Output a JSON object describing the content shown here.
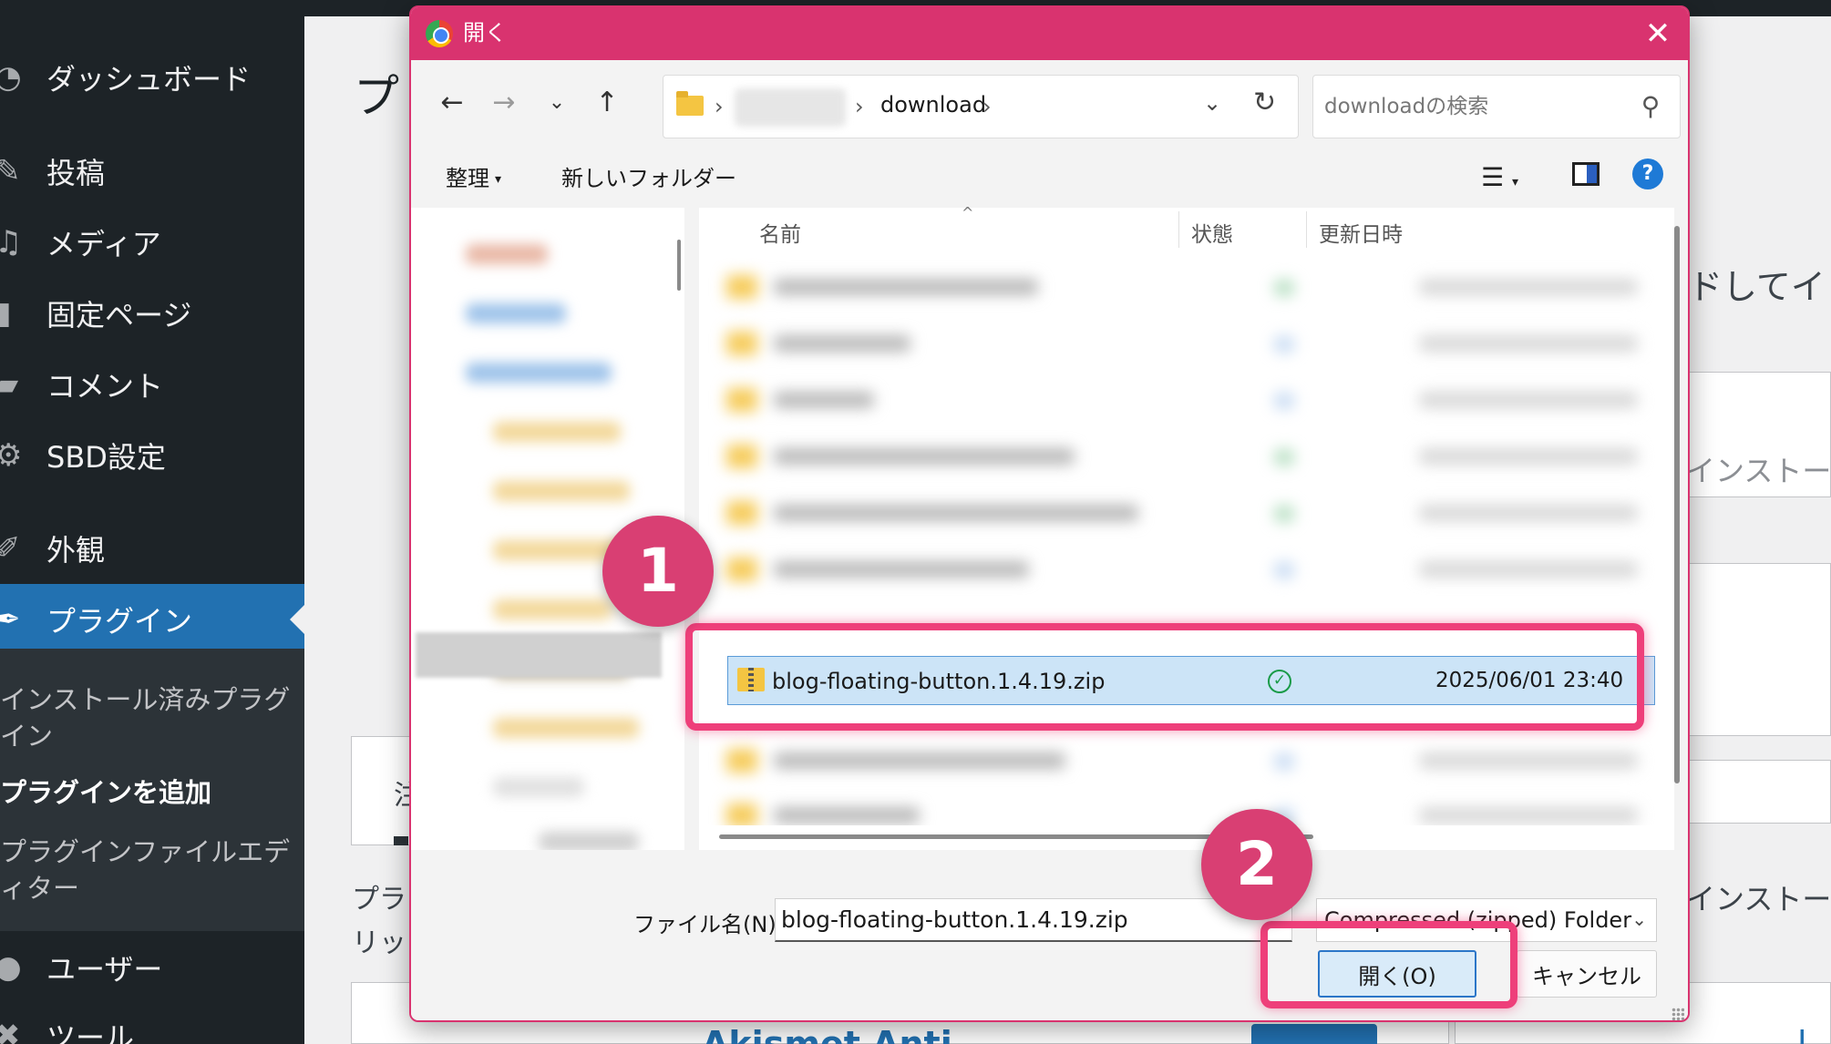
{
  "wp": {
    "sidebar": {
      "items": [
        {
          "label": "ダッシュボード",
          "icon": "dashboard-icon"
        },
        {
          "label": "投稿",
          "icon": "pin-icon"
        },
        {
          "label": "メディア",
          "icon": "media-icon"
        },
        {
          "label": "固定ページ",
          "icon": "page-icon"
        },
        {
          "label": "コメント",
          "icon": "comment-icon"
        },
        {
          "label": "SBD設定",
          "icon": "gear-icon"
        },
        {
          "label": "外観",
          "icon": "brush-icon"
        },
        {
          "label": "プラグイン",
          "icon": "plugin-icon"
        },
        {
          "label": "ユーザー",
          "icon": "user-icon"
        },
        {
          "label": "ツール",
          "icon": "wrench-icon"
        }
      ],
      "submenu": [
        "インストール済みプラグイン",
        "プラグインを追加",
        "プラグインファイルエディター"
      ]
    },
    "heading": "プ",
    "bg_text_1": "ドしてイ",
    "bg_text_2": "インストール",
    "bg_text_3": "インストール",
    "bg_text_4": "プラ",
    "bg_text_5": "リッ",
    "bg_text_6": "注",
    "bg_text_7": "Akismet Anti",
    "bg_text_8": "l"
  },
  "dialog": {
    "title": "開く",
    "address": {
      "current_folder": "download",
      "separator": "›"
    },
    "search": {
      "placeholder": "downloadの検索"
    },
    "toolbar": {
      "organize": "整理",
      "new_folder": "新しいフォルダー"
    },
    "columns": {
      "name": "名前",
      "status": "状態",
      "modified": "更新日時"
    },
    "selected_file": {
      "name": "blog-floating-button.1.4.19.zip",
      "modified": "2025/06/01 23:40",
      "status": "synced"
    },
    "filename_label": "ファイル名(N):",
    "filename_value": "blog-floating-button.1.4.19.zip",
    "filetype": "Compressed (zipped) Folder",
    "open_button": "開く(O)",
    "cancel_button": "キャンセル"
  },
  "annotations": {
    "step1": "1",
    "step2": "2",
    "highlight_color": "#ee3f7a",
    "badge_color": "#d93f73"
  },
  "colors": {
    "title_bar": "#d9336f",
    "wp_sidebar": "#1d2327",
    "wp_accent": "#2271b1",
    "selection": "#cce4f7"
  }
}
